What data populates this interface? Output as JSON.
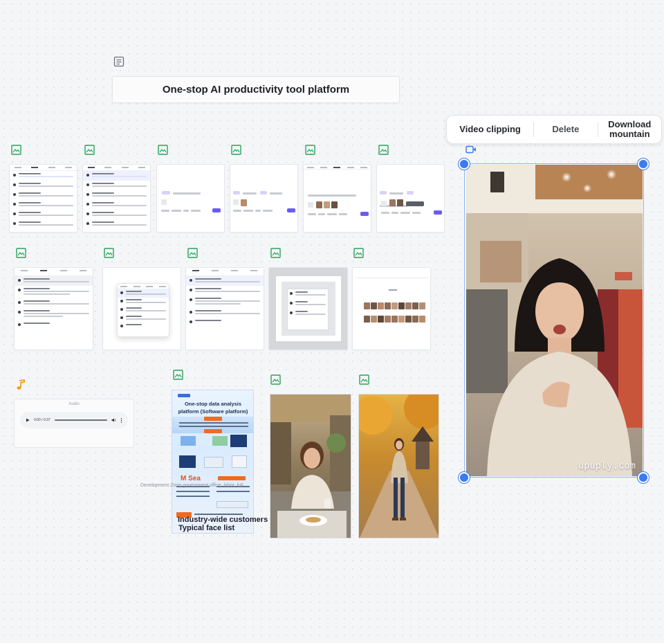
{
  "canvas": {
    "title_card": {
      "text": "One-stop AI productivity tool platform",
      "icon": "document-icon"
    }
  },
  "toolbar": {
    "video_clipping": "Video clipping",
    "delete": "Delete",
    "download": "Download mountain"
  },
  "video_node": {
    "icon": "video-icon",
    "watermark": "upuply.com"
  },
  "audio_node": {
    "icon": "music-note-icon",
    "label": "Audio",
    "time": "0:00 / 0:37"
  },
  "poster_node": {
    "title": "One-stop data analysis platform (Software platform)",
    "caption": "Development Zone government office, labor, full",
    "brand": "M Sea",
    "overlay_line1": "Industry-wide customers",
    "overlay_line2": "Typical face list"
  },
  "node_icon": "image-icon",
  "colors": {
    "accent": "#3a7bf2",
    "image_icon": "#27a35a",
    "audio_icon": "#f29a1e",
    "send": "#6b5cf0"
  }
}
